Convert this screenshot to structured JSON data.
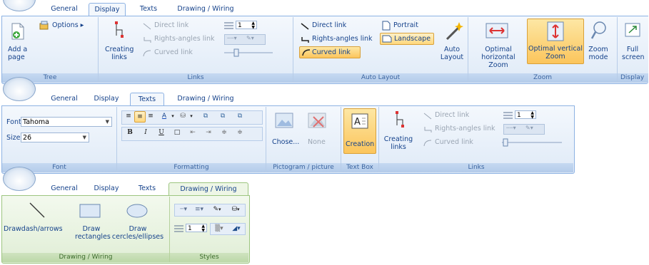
{
  "tabs": {
    "general": "General",
    "display": "Display",
    "texts": "Texts",
    "drawing": "Drawing / Wiring"
  },
  "ribbon1": {
    "tree": {
      "add_page": "Add a page",
      "options": "Options",
      "group": "Tree"
    },
    "links": {
      "creating": "Creating links",
      "direct": "Direct link",
      "rights": "Rights-angles link",
      "curved": "Curved link",
      "spin": "1",
      "group": "Links"
    },
    "autolayout": {
      "direct": "Direct link",
      "rights": "Rights-angles link",
      "curved": "Curved link",
      "portrait": "Portrait",
      "landscape": "Landscape",
      "auto_layout": "Auto Layout",
      "group": "Auto Layout"
    },
    "zoom": {
      "opt_h": "Optimal horizontal Zoom",
      "opt_v": "Optimal vertical Zoom",
      "zoom_mode": "Zoom mode",
      "group": "Zoom"
    },
    "display": {
      "full_screen": "Full screen",
      "group": "Display"
    }
  },
  "ribbon2": {
    "font": {
      "font_label": "Font",
      "font_value": "Tahoma",
      "size_label": "Size",
      "size_value": "26",
      "group": "Font"
    },
    "formatting": {
      "bold": "B",
      "italic": "I",
      "underline": "U",
      "group": "Formatting"
    },
    "pictogram": {
      "choose": "Chose...",
      "none": "None",
      "group": "Pictogram / picture"
    },
    "textbox": {
      "creation": "Creation",
      "group": "Text Box"
    },
    "links": {
      "creating": "Creating links",
      "direct": "Direct link",
      "rights": "Rights-angles link",
      "curved": "Curved link",
      "spin": "1",
      "group": "Links"
    }
  },
  "ribbon3": {
    "drawing": {
      "arrows": "Drawdash/arrows",
      "rects": "Draw rectangles",
      "ellipses": "Draw cercles/ellipses",
      "group": "Drawing / Wiring"
    },
    "styles": {
      "spin": "1",
      "group": "Styles"
    }
  },
  "colors": {
    "accent": "#15428b",
    "selected": "#fbc55c",
    "border": "#8db2e3"
  }
}
